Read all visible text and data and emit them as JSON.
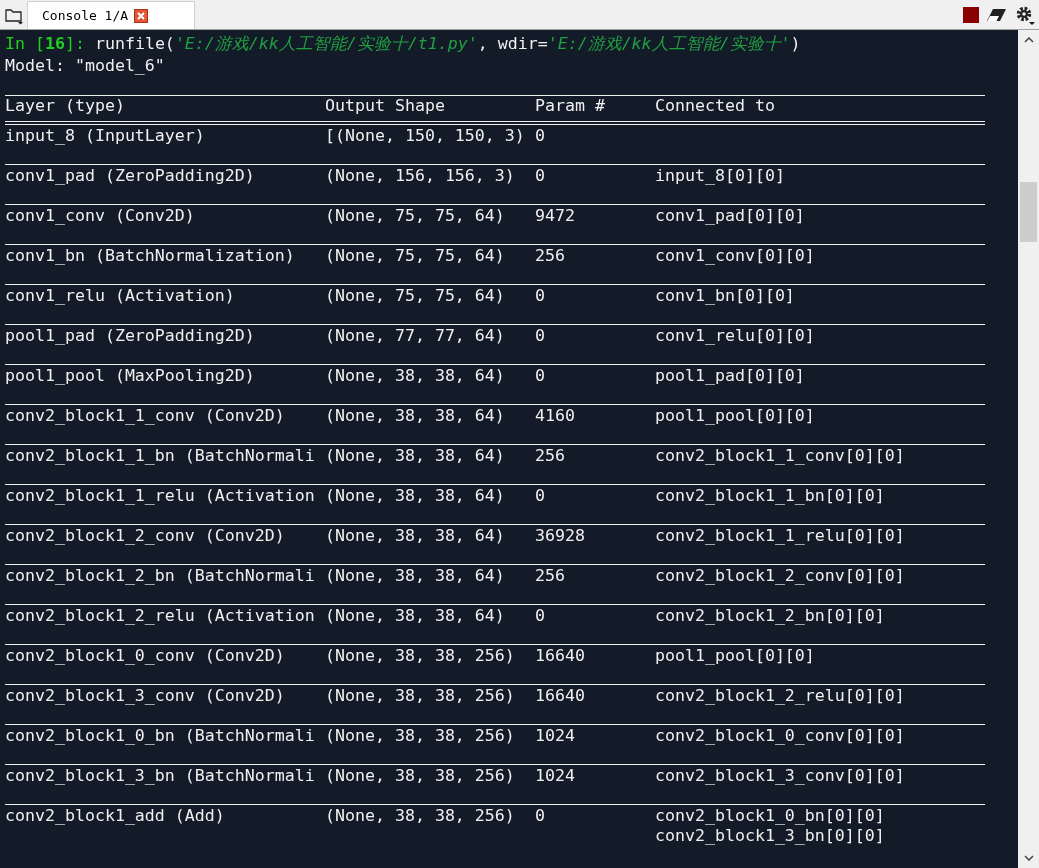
{
  "tabs": [
    {
      "label": "Console 1/A",
      "selected": true
    }
  ],
  "prompt": {
    "label_start": "In [",
    "number": "16",
    "label_end": "]:",
    "code": [
      {
        "kind": "plain",
        "text": "runfile("
      },
      {
        "kind": "string",
        "text": "'E:/游戏/kk人工智能/实验十/t1.py'"
      },
      {
        "kind": "plain",
        "text": ", wdir="
      },
      {
        "kind": "string",
        "text": "'E:/游戏/kk人工智能/实验十'"
      },
      {
        "kind": "plain",
        "text": ")"
      }
    ]
  },
  "model_line": "Model: \"model_6\"",
  "table": {
    "columns": [
      "Layer (type)",
      "Output Shape",
      "Param #",
      "Connected to"
    ],
    "rows": [
      {
        "layer": "input_8 (InputLayer)",
        "output_shape": "[(None, 150, 150, 3)",
        "params": "0"
      },
      {
        "layer": "conv1_pad (ZeroPadding2D)",
        "output_shape": "(None, 156, 156, 3)",
        "params": "0",
        "connected_to": [
          "input_8[0][0]"
        ]
      },
      {
        "layer": "conv1_conv (Conv2D)",
        "output_shape": "(None, 75, 75, 64)",
        "params": "9472",
        "connected_to": [
          "conv1_pad[0][0]"
        ]
      },
      {
        "layer": "conv1_bn (BatchNormalization)",
        "output_shape": "(None, 75, 75, 64)",
        "params": "256",
        "connected_to": [
          "conv1_conv[0][0]"
        ]
      },
      {
        "layer": "conv1_relu (Activation)",
        "output_shape": "(None, 75, 75, 64)",
        "params": "0",
        "connected_to": [
          "conv1_bn[0][0]"
        ]
      },
      {
        "layer": "pool1_pad (ZeroPadding2D)",
        "output_shape": "(None, 77, 77, 64)",
        "params": "0",
        "connected_to": [
          "conv1_relu[0][0]"
        ]
      },
      {
        "layer": "pool1_pool (MaxPooling2D)",
        "output_shape": "(None, 38, 38, 64)",
        "params": "0",
        "connected_to": [
          "pool1_pad[0][0]"
        ]
      },
      {
        "layer": "conv2_block1_1_conv (Conv2D)",
        "output_shape": "(None, 38, 38, 64)",
        "params": "4160",
        "connected_to": [
          "pool1_pool[0][0]"
        ]
      },
      {
        "layer": "conv2_block1_1_bn (BatchNormali",
        "output_shape": "(None, 38, 38, 64)",
        "params": "256",
        "connected_to": [
          "conv2_block1_1_conv[0][0]"
        ]
      },
      {
        "layer": "conv2_block1_1_relu (Activation",
        "output_shape": "(None, 38, 38, 64)",
        "params": "0",
        "connected_to": [
          "conv2_block1_1_bn[0][0]"
        ]
      },
      {
        "layer": "conv2_block1_2_conv (Conv2D)",
        "output_shape": "(None, 38, 38, 64)",
        "params": "36928",
        "connected_to": [
          "conv2_block1_1_relu[0][0]"
        ]
      },
      {
        "layer": "conv2_block1_2_bn (BatchNormali",
        "output_shape": "(None, 38, 38, 64)",
        "params": "256",
        "connected_to": [
          "conv2_block1_2_conv[0][0]"
        ]
      },
      {
        "layer": "conv2_block1_2_relu (Activation",
        "output_shape": "(None, 38, 38, 64)",
        "params": "0",
        "connected_to": [
          "conv2_block1_2_bn[0][0]"
        ]
      },
      {
        "layer": "conv2_block1_0_conv (Conv2D)",
        "output_shape": "(None, 38, 38, 256)",
        "params": "16640",
        "connected_to": [
          "pool1_pool[0][0]"
        ]
      },
      {
        "layer": "conv2_block1_3_conv (Conv2D)",
        "output_shape": "(None, 38, 38, 256)",
        "params": "16640",
        "connected_to": [
          "conv2_block1_2_relu[0][0]"
        ]
      },
      {
        "layer": "conv2_block1_0_bn (BatchNormali",
        "output_shape": "(None, 38, 38, 256)",
        "params": "1024",
        "connected_to": [
          "conv2_block1_0_conv[0][0]"
        ]
      },
      {
        "layer": "conv2_block1_3_bn (BatchNormali",
        "output_shape": "(None, 38, 38, 256)",
        "params": "1024",
        "connected_to": [
          "conv2_block1_3_conv[0][0]"
        ]
      },
      {
        "layer": "conv2_block1_add (Add)",
        "output_shape": "(None, 38, 38, 256)",
        "params": "0",
        "connected_to": [
          "conv2_block1_0_bn[0][0]",
          "conv2_block1_3_bn[0][0]"
        ]
      }
    ]
  }
}
